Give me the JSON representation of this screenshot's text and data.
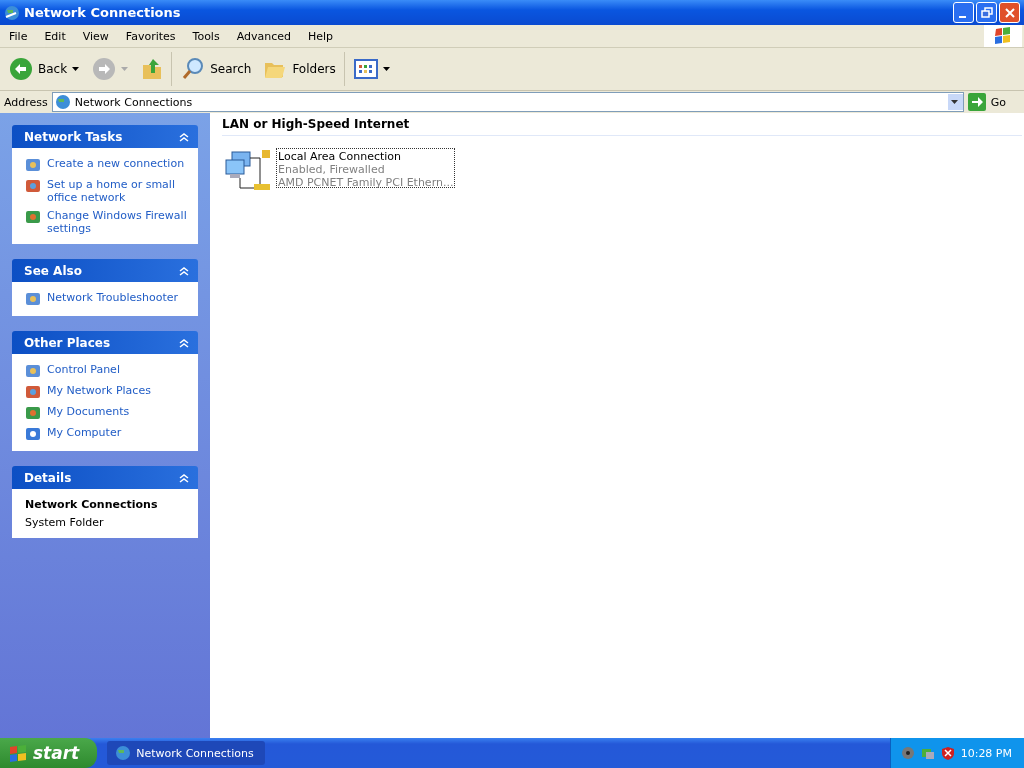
{
  "window": {
    "title": "Network Connections"
  },
  "menu": [
    "File",
    "Edit",
    "View",
    "Favorites",
    "Tools",
    "Advanced",
    "Help"
  ],
  "toolbar": [
    {
      "kind": "back",
      "label": "Back"
    },
    {
      "kind": "forward"
    },
    {
      "kind": "up"
    },
    {
      "kind": "search",
      "label": "Search"
    },
    {
      "kind": "folders",
      "label": "Folders"
    },
    {
      "kind": "views"
    }
  ],
  "address": {
    "label": "Address",
    "value": "Network Connections",
    "go": "Go"
  },
  "sidebar": [
    {
      "kind": "links",
      "title": "Network Tasks",
      "items": [
        "Create a new connection",
        "Set up a home or small office network",
        "Change Windows Firewall settings"
      ]
    },
    {
      "kind": "links",
      "title": "See Also",
      "items": [
        "Network Troubleshooter"
      ]
    },
    {
      "kind": "links",
      "title": "Other Places",
      "items": [
        "Control Panel",
        "My Network Places",
        "My Documents",
        "My Computer"
      ]
    },
    {
      "kind": "details",
      "title": "Details",
      "name": "Network Connections",
      "type": "System Folder"
    }
  ],
  "group": {
    "title": "LAN or High-Speed Internet",
    "items": [
      {
        "name": "Local Area Connection",
        "status": "Enabled, Firewalled",
        "device": "AMD PCNET Family PCI Ethern...",
        "selected": true
      }
    ]
  },
  "taskbar": {
    "start": "start",
    "tasks": [
      {
        "label": "Network Connections",
        "selected": true
      }
    ],
    "clock": "10:28 PM"
  }
}
